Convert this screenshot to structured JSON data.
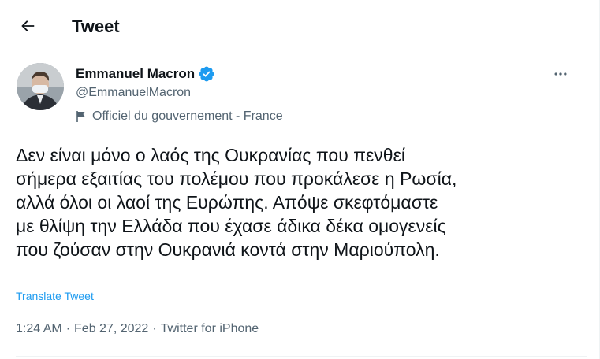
{
  "header": {
    "title": "Tweet",
    "back_icon": "arrow-left-icon"
  },
  "author": {
    "display_name": "Emmanuel Macron",
    "handle": "@EmmanuelMacron",
    "verified": true,
    "label": "Officiel du gouvernement - France",
    "label_icon": "flag-icon",
    "more_icon": "more-horizontal-icon"
  },
  "tweet": {
    "text": "Δεν είναι μόνο ο λαός της Ουκρανίας που πενθεί\nσήμερα εξαιτίας του πολέμου που προκάλεσε η Ρωσία,\nαλλά όλοι οι λαοί της Ευρώπης. Απόψε σκεφτόμαστε\nμε θλίψη την Ελλάδα που έχασε άδικα δέκα ομογενείς\nπου ζούσαν στην Ουκρανιά κοντά στην Μαριούπολη.",
    "translate_label": "Translate Tweet"
  },
  "meta": {
    "time": "1:24 AM",
    "date": "Feb 27, 2022",
    "source": "Twitter for iPhone",
    "separator": "·"
  },
  "colors": {
    "text": "#0f1419",
    "secondary": "#536471",
    "accent": "#1d9bf0",
    "divider": "#eff3f4"
  }
}
